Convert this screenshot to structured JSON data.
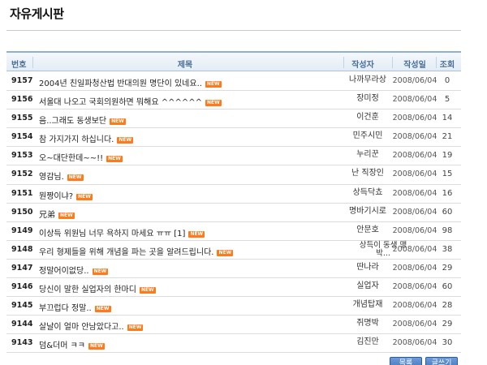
{
  "board": {
    "title": "자유게시판"
  },
  "columns": {
    "num": "번호",
    "title": "제목",
    "writer": "작성자",
    "date": "작성일",
    "views": "조회"
  },
  "new_badge": "NEW",
  "accent_color": "#ff7a1a",
  "header_color": "#4a6f96",
  "posts": [
    {
      "num": "9157",
      "title": "2004년 친일파청산법 반대의원 명단이 있네요..",
      "writer": "나까무라상",
      "date": "2008/06/04",
      "views": "0"
    },
    {
      "num": "9156",
      "title": "서울대 나오고 국회의원하면 뭐해요 ^^^^^^",
      "writer": "장미정",
      "date": "2008/06/04",
      "views": "5"
    },
    {
      "num": "9155",
      "title": "음..그래도 동생보단",
      "writer": "이건훈",
      "date": "2008/06/04",
      "views": "14"
    },
    {
      "num": "9154",
      "title": "참 가지가지 하십니다.",
      "writer": "민주시민",
      "date": "2008/06/04",
      "views": "21"
    },
    {
      "num": "9153",
      "title": "오~대단한데~~!!",
      "writer": "누리꾼",
      "date": "2008/06/04",
      "views": "19"
    },
    {
      "num": "9152",
      "title": "영감님.",
      "writer": "난 직장인",
      "date": "2008/06/04",
      "views": "15"
    },
    {
      "num": "9151",
      "title": "뭔짱이냐?",
      "writer": "상득닥쵸",
      "date": "2008/06/04",
      "views": "16"
    },
    {
      "num": "9150",
      "title": "兄弟",
      "writer": "명바기시로",
      "date": "2008/06/04",
      "views": "60"
    },
    {
      "num": "9149",
      "title": "이상득 위원님 너무 욕하지 마세요 ㅠㅠ [1]",
      "writer": "안문호",
      "date": "2008/06/04",
      "views": "98"
    },
    {
      "num": "9148",
      "title": "우리 형제들을 위해 개념을 파는 곳을 알려드립니다.",
      "writer": "상득이 동생 맹박...",
      "date": "2008/06/04",
      "views": "38"
    },
    {
      "num": "9147",
      "title": "정말어이없당..",
      "writer": "딴나라",
      "date": "2008/06/04",
      "views": "29"
    },
    {
      "num": "9146",
      "title": "당신이 말한 실업자의 한마디",
      "writer": "실업자",
      "date": "2008/06/04",
      "views": "60"
    },
    {
      "num": "9145",
      "title": "부끄럽다 정말..",
      "writer": "개념탑재",
      "date": "2008/06/04",
      "views": "28"
    },
    {
      "num": "9144",
      "title": "살날이 얼마 안남았다고..",
      "writer": "쥐명박",
      "date": "2008/06/04",
      "views": "29"
    },
    {
      "num": "9143",
      "title": "덤&더머 ㅋㅋ",
      "writer": "김진만",
      "date": "2008/06/04",
      "views": "30"
    }
  ],
  "buttons": {
    "list": "목록",
    "write": "글쓰기"
  }
}
